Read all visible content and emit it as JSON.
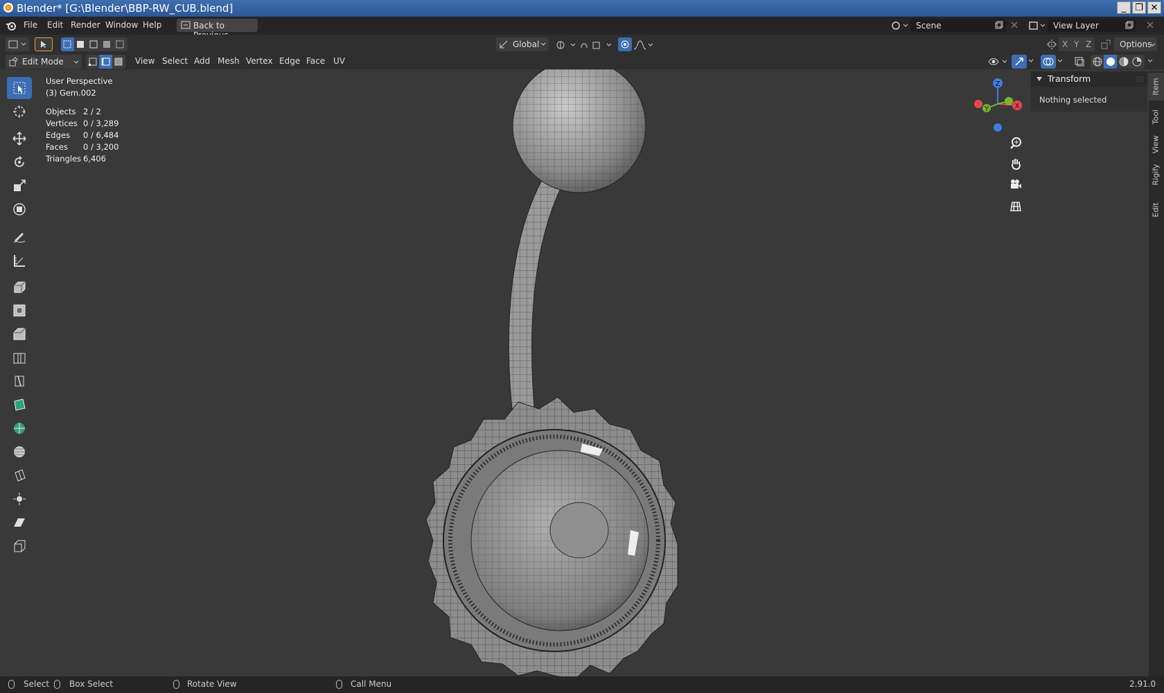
{
  "window": {
    "title": "Blender* [G:\\Blender\\BBP-RW_CUB.blend]",
    "buttons": [
      "_",
      "❐",
      "✕"
    ]
  },
  "menubar": {
    "items": [
      "File",
      "Edit",
      "Render",
      "Window",
      "Help"
    ],
    "back_label": "Back to Previous",
    "scene_value": "Scene",
    "view_layer_value": "View Layer"
  },
  "tool_header": {
    "orientation": "Global",
    "axes": [
      "X",
      "Y",
      "Z"
    ],
    "options_label": "Options"
  },
  "view_header": {
    "mode": "Edit Mode",
    "menus": [
      "View",
      "Select",
      "Add",
      "Mesh",
      "Vertex",
      "Edge",
      "Face",
      "UV"
    ]
  },
  "overlay": {
    "perspective": "User Perspective",
    "object_name": "(3) Gem.002",
    "stats": [
      {
        "label": "Objects",
        "value": "2 / 2"
      },
      {
        "label": "Vertices",
        "value": "0 / 3,289"
      },
      {
        "label": "Edges",
        "value": "0 / 6,484"
      },
      {
        "label": "Faces",
        "value": "0 / 3,200"
      },
      {
        "label": "Triangles",
        "value": "6,406"
      }
    ]
  },
  "gizmo": {
    "labels": [
      "Z",
      "Y",
      "X"
    ],
    "colors": {
      "x": "#e8464e",
      "y": "#7ab32e",
      "z": "#3d7fe0"
    }
  },
  "sidebar": {
    "panel_title": "Transform",
    "panel_text": "Nothing selected",
    "tabs": [
      "Item",
      "Tool",
      "View",
      "Rigify",
      "Edit"
    ]
  },
  "statusbar": {
    "items": [
      "Select",
      "Box Select",
      "Rotate View",
      "Call Menu"
    ],
    "version": "2.91.0"
  },
  "colors": {
    "active_blue": "#3c6eb4",
    "viewport_bg": "#393939"
  }
}
